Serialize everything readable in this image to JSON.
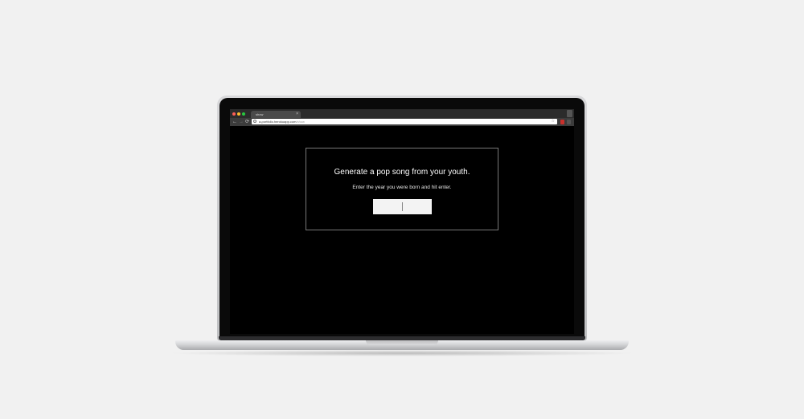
{
  "browser": {
    "tab_title": "show",
    "tab_close": "×",
    "url_host": "a-portfolio.herokuapp.com",
    "url_path": "/show",
    "back_glyph": "←",
    "forward_glyph": "→",
    "reload_glyph": "⟳",
    "star_glyph": "☆",
    "traffic_colors": [
      "#ff5f57",
      "#febc2e",
      "#28c840"
    ]
  },
  "page": {
    "headline": "Generate a pop song from your youth.",
    "instruction": "Enter the year you were born and hit enter.",
    "year_input_value": ""
  },
  "colors": {
    "background": "#f1f1f1",
    "screen": "#000000",
    "text": "#ffffff",
    "box_border": "#777777",
    "input_bg": "#f3f3f3"
  }
}
